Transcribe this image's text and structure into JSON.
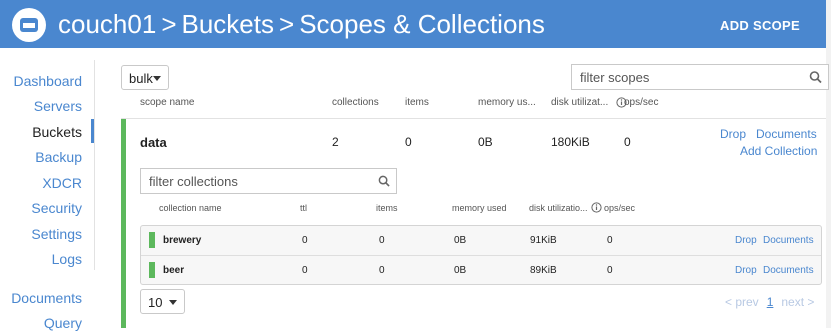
{
  "header": {
    "crumbs": [
      "couch01",
      "Buckets",
      "Scopes & Collections"
    ],
    "separator": ">",
    "add_scope": "ADD SCOPE"
  },
  "sidebar": {
    "items": [
      {
        "label": "Dashboard"
      },
      {
        "label": "Servers"
      },
      {
        "label": "Buckets"
      },
      {
        "label": "Backup"
      },
      {
        "label": "XDCR"
      },
      {
        "label": "Security"
      },
      {
        "label": "Settings"
      },
      {
        "label": "Logs"
      },
      {
        "label": "Documents"
      },
      {
        "label": "Query"
      }
    ],
    "active": "Buckets"
  },
  "toolbar": {
    "bucket_select": "bulk",
    "filter_scopes_placeholder": "filter scopes"
  },
  "scope_columns": [
    "scope name",
    "collections",
    "items",
    "memory us...",
    "disk utilizat...",
    "ops/sec"
  ],
  "scope": {
    "name": "data",
    "collections": "2",
    "items": "0",
    "memory": "0B",
    "disk": "180KiB",
    "ops": "0",
    "drop": "Drop",
    "documents": "Documents",
    "add_collection": "Add Collection"
  },
  "collections": {
    "filter_placeholder": "filter collections",
    "columns": [
      "collection name",
      "ttl",
      "items",
      "memory used",
      "disk utilizatio...",
      "ops/sec"
    ],
    "rows": [
      {
        "name": "brewery",
        "ttl": "0",
        "items": "0",
        "memory": "0B",
        "disk": "91KiB",
        "ops": "0",
        "drop": "Drop",
        "documents": "Documents"
      },
      {
        "name": "beer",
        "ttl": "0",
        "items": "0",
        "memory": "0B",
        "disk": "89KiB",
        "ops": "0",
        "drop": "Drop",
        "documents": "Documents"
      }
    ]
  },
  "pagination": {
    "page_size": "10",
    "prev": "< prev",
    "current": "1",
    "next": "next >"
  },
  "colors": {
    "header_blue": "#4a87cf",
    "accent_green": "#5cb85c",
    "link_blue": "#4a87cf"
  }
}
